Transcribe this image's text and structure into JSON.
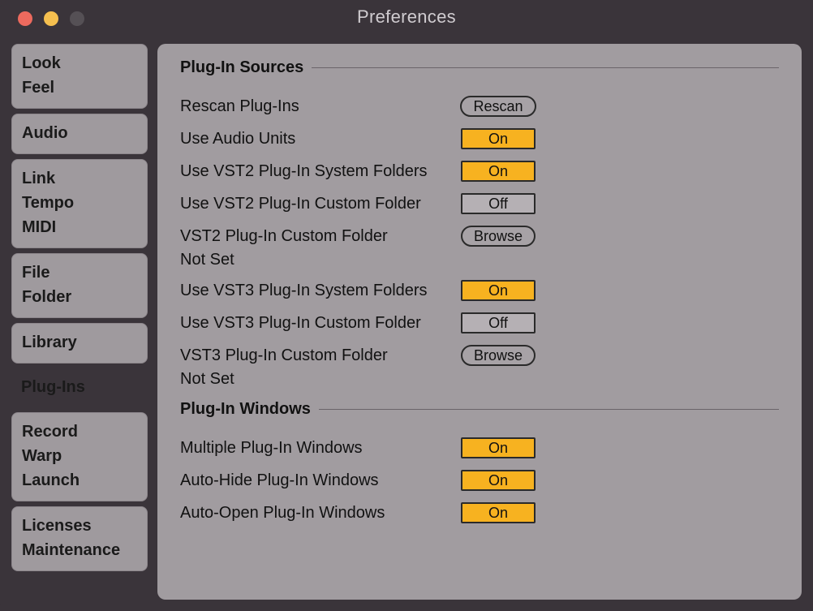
{
  "window": {
    "title": "Preferences"
  },
  "sidebar": {
    "tabs": [
      {
        "lines": [
          "Look",
          "Feel"
        ]
      },
      {
        "lines": [
          "Audio"
        ]
      },
      {
        "lines": [
          "Link",
          "Tempo",
          "MIDI"
        ]
      },
      {
        "lines": [
          "File",
          "Folder"
        ]
      },
      {
        "lines": [
          "Library"
        ]
      },
      {
        "lines": [
          "Plug-Ins"
        ],
        "selected": true
      },
      {
        "lines": [
          "Record",
          "Warp",
          "Launch"
        ]
      },
      {
        "lines": [
          "Licenses",
          "Maintenance"
        ]
      }
    ]
  },
  "sections": {
    "sources": {
      "title": "Plug-In Sources",
      "rescan_label": "Rescan Plug-Ins",
      "rescan_button": "Rescan",
      "use_au_label": "Use Audio Units",
      "use_au_value": "On",
      "use_vst2_sys_label": "Use VST2 Plug-In System Folders",
      "use_vst2_sys_value": "On",
      "use_vst2_cust_label": "Use VST2 Plug-In Custom Folder",
      "use_vst2_cust_value": "Off",
      "vst2_cust_folder_label": "VST2 Plug-In Custom Folder",
      "vst2_cust_folder_browse": "Browse",
      "vst2_cust_folder_value": "Not Set",
      "use_vst3_sys_label": "Use VST3 Plug-In System Folders",
      "use_vst3_sys_value": "On",
      "use_vst3_cust_label": "Use VST3 Plug-In Custom Folder",
      "use_vst3_cust_value": "Off",
      "vst3_cust_folder_label": "VST3 Plug-In Custom Folder",
      "vst3_cust_folder_browse": "Browse",
      "vst3_cust_folder_value": "Not Set"
    },
    "windows": {
      "title": "Plug-In Windows",
      "multi_label": "Multiple Plug-In Windows",
      "multi_value": "On",
      "autohide_label": "Auto-Hide Plug-In Windows",
      "autohide_value": "On",
      "autoopen_label": "Auto-Open Plug-In Windows",
      "autoopen_value": "On"
    }
  },
  "colors": {
    "accent_toggle_on": "#f7b220"
  }
}
